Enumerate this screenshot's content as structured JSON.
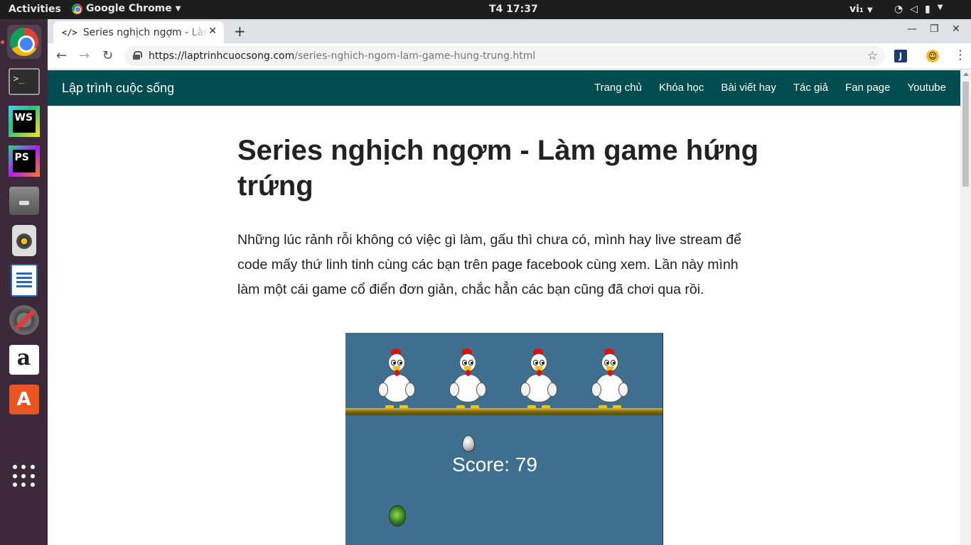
{
  "system_bar": {
    "activities": "Activities",
    "app_name": "Google Chrome",
    "clock": "T4 17:37",
    "language": "vi₁"
  },
  "browser": {
    "tab_title": "Series nghịch ngợm - Làm game hứng trứng",
    "url_host": "https://laptrinhcuocsong.com",
    "url_path": "/series-nghich-ngom-lam-game-hung-trung.html"
  },
  "site": {
    "brand": "Lập trình cuộc sống",
    "nav": [
      "Trang chủ",
      "Khóa học",
      "Bài viết hay",
      "Tác giả",
      "Fan page",
      "Youtube"
    ]
  },
  "article": {
    "title": "Series nghịch ngợm - Làm game hứng trứng",
    "intro": "Những lúc rảnh rỗi không có việc gì làm, gấu thì chưa có, mình hay live stream để code mấy thứ linh tinh cùng các bạn trên page facebook cùng xem. Lần này mình làm một cái game cổ điển đơn giản, chắc hẳn các bạn cũng đã chơi qua rồi."
  },
  "game": {
    "score_label": "Score: 79",
    "chicken_count": 4,
    "background_color": "#3e6f8f"
  },
  "colors": {
    "nav_bg": "#004d4f",
    "dock_bg": "#3c2a3a"
  }
}
